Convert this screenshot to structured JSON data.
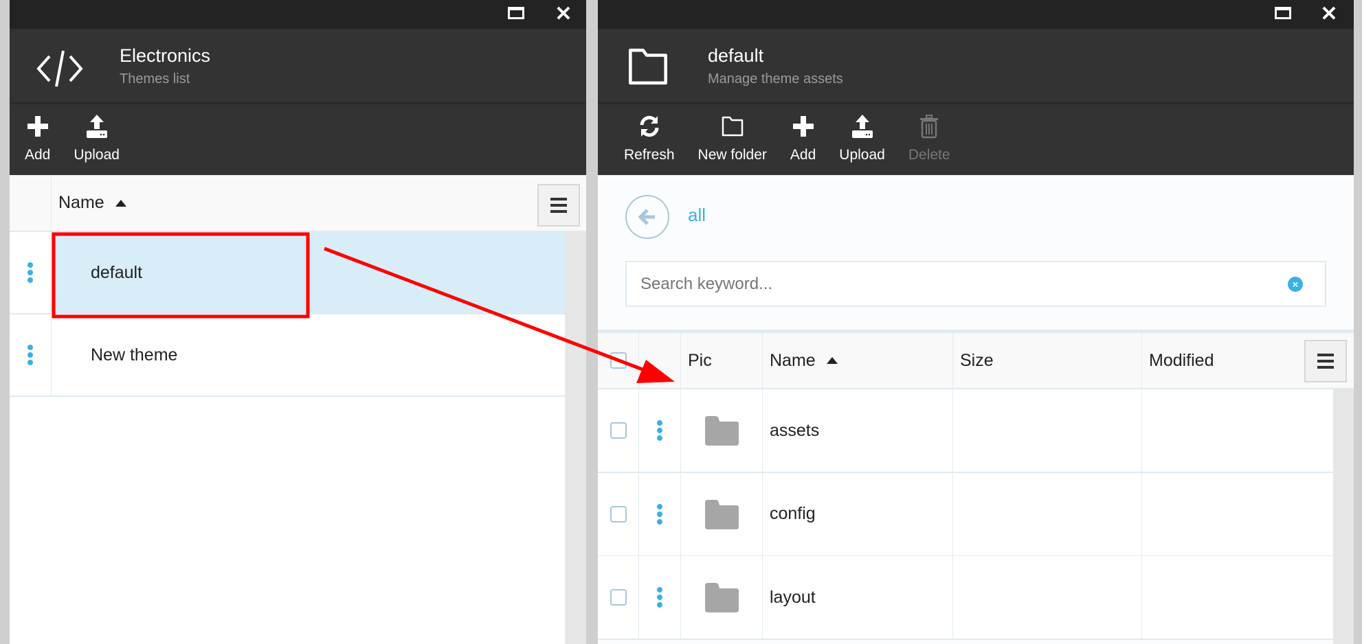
{
  "left": {
    "title": "Electronics",
    "subtitle": "Themes list",
    "header_icon": "code-icon",
    "toolbar": [
      {
        "label": "Add",
        "icon": "plus-icon"
      },
      {
        "label": "Upload",
        "icon": "upload-icon"
      }
    ],
    "columns": {
      "name": "Name",
      "sort": "ascending"
    },
    "rows": [
      {
        "name": "default",
        "selected": true
      },
      {
        "name": "New theme",
        "selected": false
      }
    ]
  },
  "right": {
    "title": "default",
    "subtitle": "Manage theme assets",
    "header_icon": "folder-icon",
    "toolbar": [
      {
        "label": "Refresh",
        "icon": "refresh-icon",
        "disabled": false
      },
      {
        "label": "New folder",
        "icon": "folder-icon",
        "disabled": false
      },
      {
        "label": "Add",
        "icon": "plus-icon",
        "disabled": false
      },
      {
        "label": "Upload",
        "icon": "upload-icon",
        "disabled": false
      },
      {
        "label": "Delete",
        "icon": "trash-icon",
        "disabled": true
      }
    ],
    "breadcrumb": {
      "label": "all"
    },
    "search": {
      "placeholder": "Search keyword...",
      "value": ""
    },
    "columns": {
      "pic": "Pic",
      "name": "Name",
      "size": "Size",
      "modified": "Modified",
      "sort": "Name ascending"
    },
    "rows": [
      {
        "name": "assets",
        "size": "",
        "modified": ""
      },
      {
        "name": "config",
        "size": "",
        "modified": ""
      },
      {
        "name": "layout",
        "size": "",
        "modified": ""
      }
    ]
  },
  "colors": {
    "accent": "#3bb0e6",
    "selected_row": "#d8edf8",
    "annotation": "#ff0000",
    "header_bg": "#333333"
  }
}
